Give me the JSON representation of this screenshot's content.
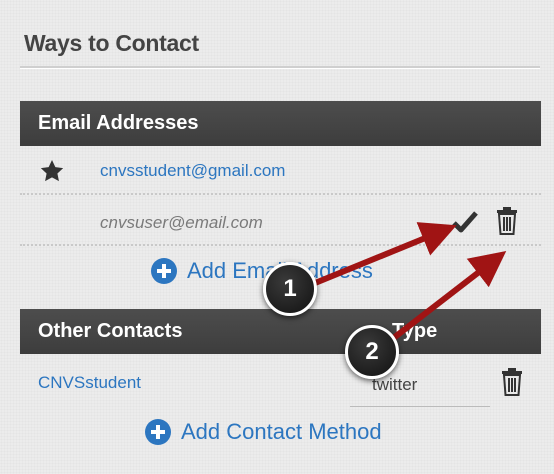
{
  "section_title": "Ways to Contact",
  "email": {
    "header": "Email Addresses",
    "primary": "cnvsstudent@gmail.com",
    "secondary": "cnvsuser@email.com",
    "add_label": "Add Email Address"
  },
  "other": {
    "header": "Other Contacts",
    "type_header": "Type",
    "contact_value": "CNVSstudent",
    "contact_type": "twitter",
    "add_label": "Add Contact Method"
  },
  "callouts": {
    "one": "1",
    "two": "2"
  },
  "colors": {
    "link": "#2c76c0",
    "header_bg": "#444444",
    "arrow": "#a01414"
  },
  "icons": [
    "star-icon",
    "checkmark-icon",
    "trash-icon",
    "plus-circle-icon"
  ]
}
